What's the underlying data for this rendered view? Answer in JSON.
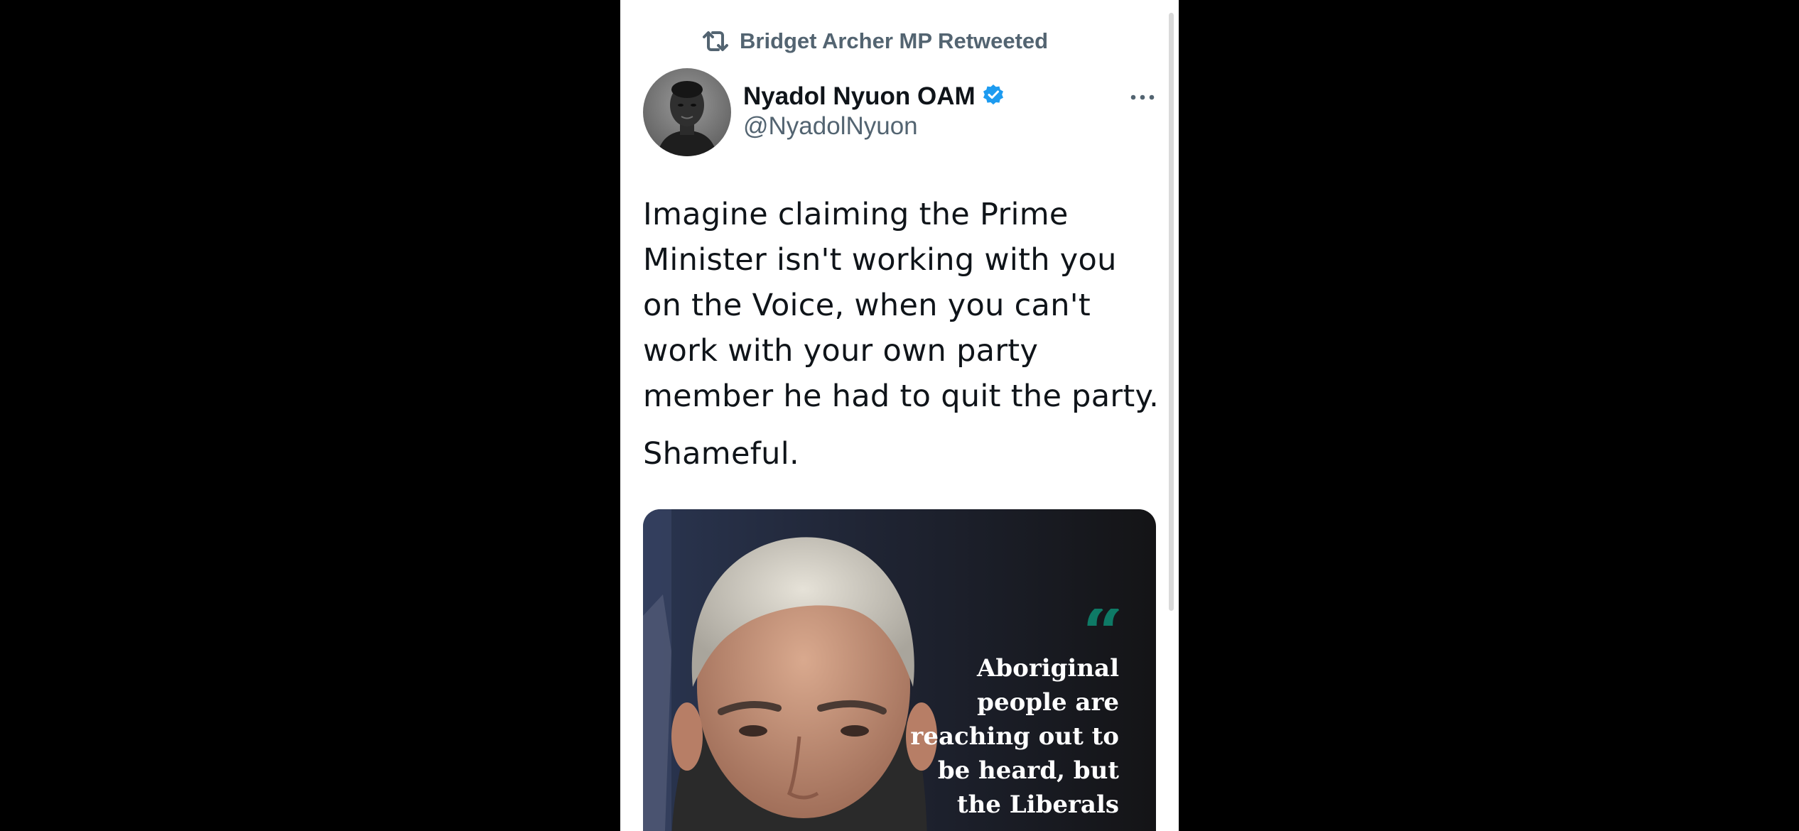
{
  "retweet": {
    "icon": "retweet-icon",
    "label": "Bridget Archer MP Retweeted"
  },
  "author": {
    "name": "Nyadol Nyuon OAM",
    "handle": "@NyadolNyuon",
    "verified_icon": "verified-badge-icon",
    "verified_color": "#1d9bf0"
  },
  "tweet": {
    "paragraphs": [
      "Imagine claiming the Prime Minister isn't working with you on the Voice, when you can't work with your own party member he had to quit the party.",
      "Shameful."
    ]
  },
  "media": {
    "quote_lines": [
      "Aboriginal",
      "people are",
      "reaching out to",
      "be heard, but",
      "the Liberals"
    ],
    "quote_mark": "“",
    "accent_color": "#0e7a66"
  },
  "colors": {
    "text_primary": "#0f1419",
    "text_secondary": "#536471",
    "background": "#ffffff",
    "letterbox": "#000000"
  }
}
